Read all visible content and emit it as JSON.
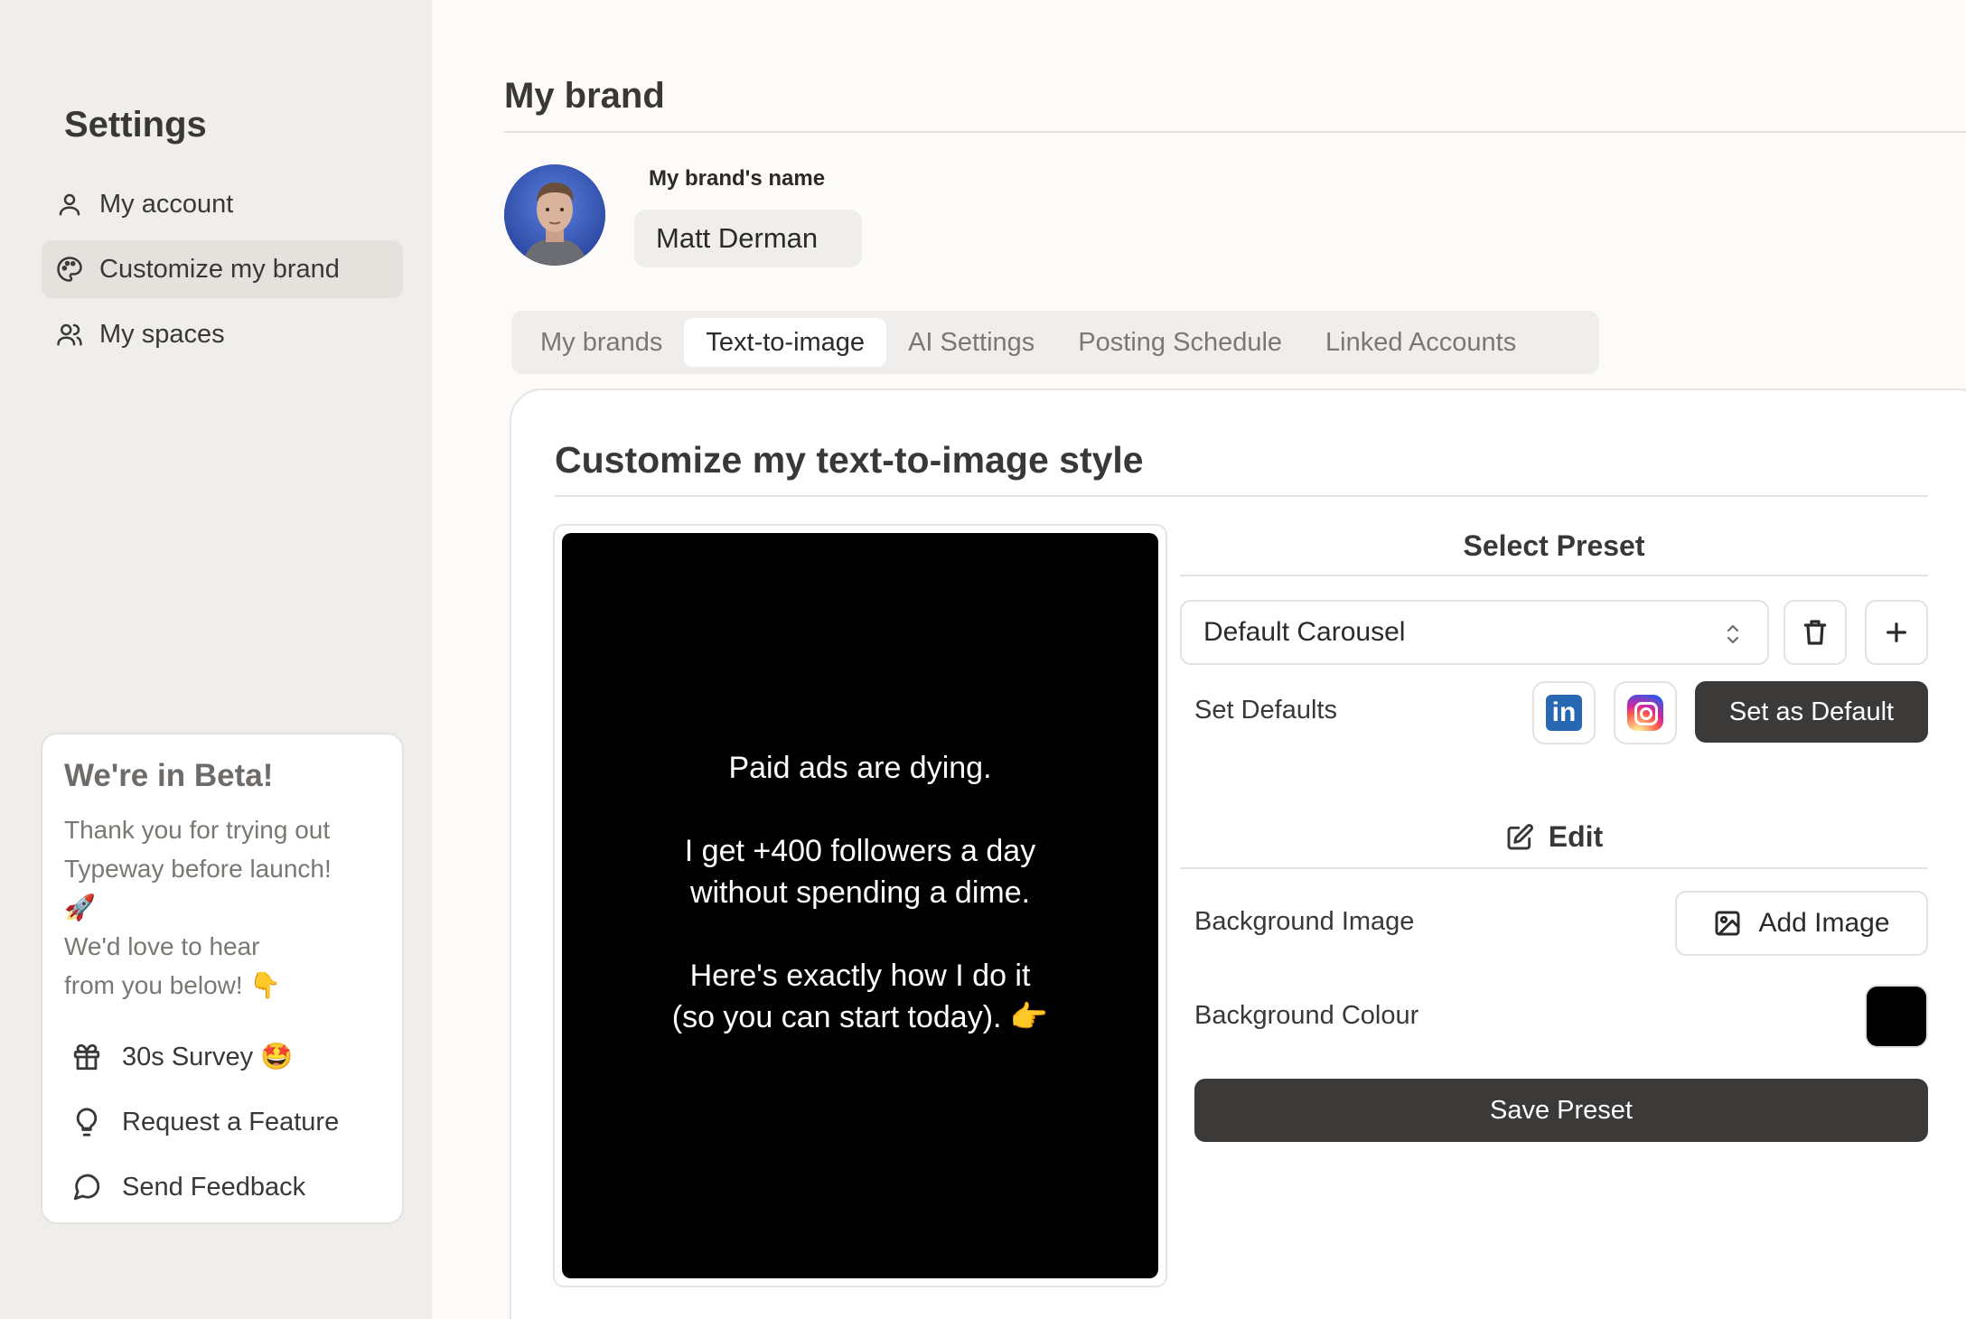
{
  "sidebar": {
    "title": "Settings",
    "items": [
      {
        "label": "My account",
        "icon": "user-icon"
      },
      {
        "label": "Customize my brand",
        "icon": "palette-icon",
        "active": true
      },
      {
        "label": "My spaces",
        "icon": "users-icon"
      }
    ],
    "beta": {
      "title": "We're in Beta!",
      "text": "Thank you for trying out\nTypeway before launch!\n🚀\nWe'd love to hear\nfrom you below! 👇",
      "links": [
        {
          "label": "30s Survey 🤩",
          "icon": "gift-icon"
        },
        {
          "label": "Request a Feature",
          "icon": "lightbulb-icon"
        },
        {
          "label": "Send Feedback",
          "icon": "message-circle-icon"
        }
      ]
    }
  },
  "main": {
    "title": "My brand",
    "brand_name_label": "My brand's name",
    "brand_name_value": "Matt Derman",
    "tabs": [
      {
        "label": "My brands"
      },
      {
        "label": "Text-to-image",
        "active": true
      },
      {
        "label": "AI Settings"
      },
      {
        "label": "Posting Schedule"
      },
      {
        "label": "Linked Accounts"
      }
    ],
    "panel": {
      "title": "Customize my text-to-image style",
      "preview_text": "Paid ads are dying.\n\nI get +400 followers a day\nwithout spending a dime.\n\nHere's exactly how I do it\n(so you can start today). 👉",
      "select_preset_heading": "Select Preset",
      "preset_value": "Default Carousel",
      "set_defaults_label": "Set Defaults",
      "linkedin_glyph": "in",
      "set_default_button": "Set as Default",
      "edit_heading": "Edit",
      "background_image_label": "Background Image",
      "add_image_button": "Add Image",
      "background_colour_label": "Background Colour",
      "background_colour_value": "#000000",
      "save_button": "Save Preset"
    }
  },
  "colors": {
    "sidebar_bg": "#efeeec",
    "accent_dark": "#3b3a39",
    "linkedin": "#2867b2"
  }
}
